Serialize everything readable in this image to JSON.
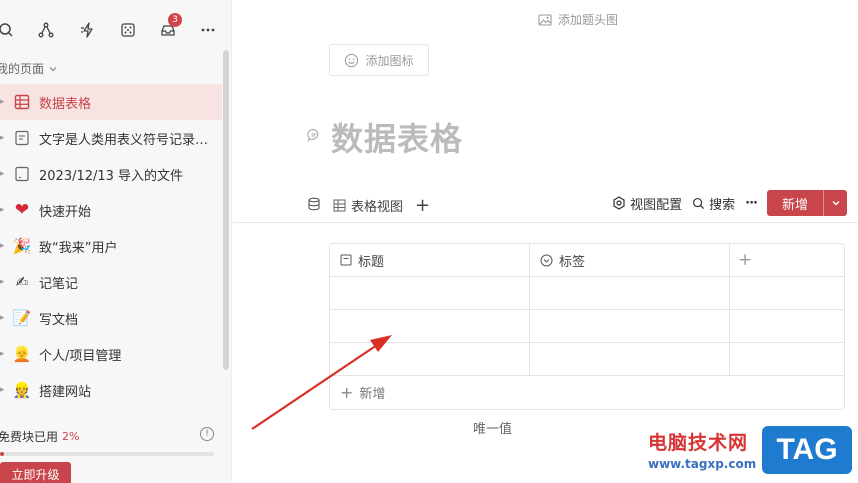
{
  "sidebar": {
    "toolbar_badge": "3",
    "section_title": "我的页面",
    "items": [
      {
        "label": "数据表格",
        "icon": "table-icon",
        "active": true
      },
      {
        "label": "文字是人类用表义符号记录表达信息以...",
        "icon": "doc-icon"
      },
      {
        "label": "2023/12/13 导入的文件",
        "icon": "page-icon"
      },
      {
        "label": "快速开始",
        "icon": "heart-icon"
      },
      {
        "label": "致“我来”用户",
        "icon": "party-icon"
      },
      {
        "label": "记笔记",
        "icon": "writing-hand-icon"
      },
      {
        "label": "写文档",
        "icon": "document-icon"
      },
      {
        "label": "个人/项目管理",
        "icon": "person-icon"
      },
      {
        "label": "搭建网站",
        "icon": "builder-icon"
      }
    ],
    "quota_label": "免费块已用",
    "quota_pct": "2%",
    "quota_fraction": 0.02,
    "info_glyph": "!",
    "upgrade_label": "立即升级"
  },
  "main": {
    "add_cover": "添加题头图",
    "add_icon": "添加图标",
    "title": "数据表格",
    "view_name": "表格视图",
    "add_view": "+",
    "view_config": "视图配置",
    "search": "搜索",
    "more": "···",
    "new_button": "新增",
    "table": {
      "columns": [
        "标题",
        "标签"
      ],
      "add_column": "+",
      "rows": [
        [
          "",
          ""
        ],
        [
          "",
          ""
        ],
        [
          "",
          ""
        ]
      ],
      "add_row": "新增"
    },
    "unique_label": "唯一值"
  },
  "watermark": {
    "site_name": "电脑技术网",
    "url": "www.tagxp.com",
    "tag": "TAG"
  },
  "colors": {
    "accent": "#c8464b",
    "active_bg": "#f8e3e3",
    "arrow": "#d93025"
  }
}
